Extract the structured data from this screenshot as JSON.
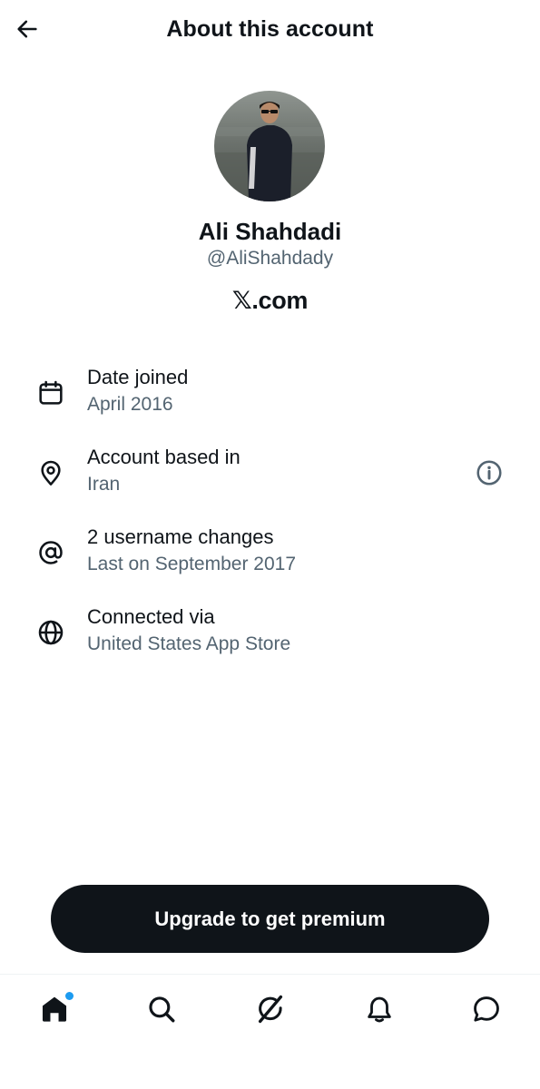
{
  "header": {
    "title": "About this account",
    "back_icon": "arrow-left-icon"
  },
  "profile": {
    "name": "Ali Shahdadi",
    "handle": "@AliShahdady",
    "brand_glyph": "𝕏",
    "brand_suffix": ".com"
  },
  "info": [
    {
      "icon": "calendar-icon",
      "title": "Date joined",
      "subtitle": "April 2016"
    },
    {
      "icon": "location-pin-icon",
      "title": "Account based in",
      "subtitle": "Iran",
      "action_icon": "info-icon"
    },
    {
      "icon": "at-sign-icon",
      "title": "2 username changes",
      "subtitle": "Last on September 2017"
    },
    {
      "icon": "globe-icon",
      "title": "Connected via",
      "subtitle": "United States App Store"
    }
  ],
  "premium_button": {
    "label": "Upgrade to get premium"
  },
  "nav": {
    "items": [
      {
        "icon": "home-icon",
        "active": true,
        "has_dot": true
      },
      {
        "icon": "search-icon",
        "active": false
      },
      {
        "icon": "grok-icon",
        "active": false
      },
      {
        "icon": "bell-icon",
        "active": false
      },
      {
        "icon": "message-icon",
        "active": false
      }
    ]
  },
  "colors": {
    "text_primary": "#0f1419",
    "text_secondary": "#536471",
    "button_bg": "#0f1419",
    "notification_dot": "#1d9bf0",
    "divider": "#eff3f4"
  }
}
